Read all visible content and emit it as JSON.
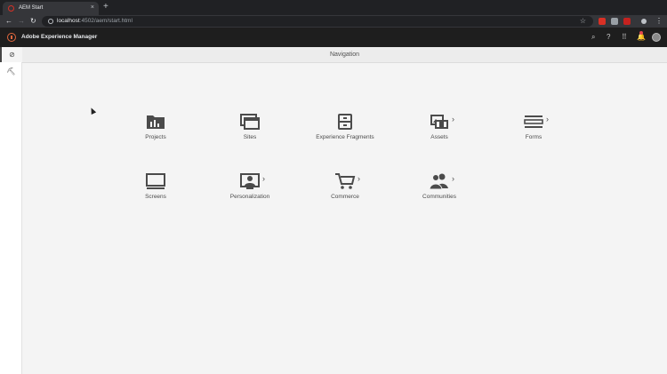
{
  "browser": {
    "tab_title": "AEM Start",
    "tab_close": "×",
    "new_tab": "+",
    "url_host": "localhost",
    "url_rest": ":4502/aem/start.html",
    "star": "☆"
  },
  "appbar": {
    "title": "Adobe Experience Manager",
    "brand_color": "#e3683e",
    "icons": [
      "search-icon",
      "help-icon",
      "apps-grid-icon",
      "notifications-icon",
      "user-avatar"
    ]
  },
  "rail": {
    "items": [
      {
        "icon": "compass-icon",
        "glyph": "⊘"
      },
      {
        "icon": "tools-icon",
        "glyph": "⛏"
      }
    ]
  },
  "page": {
    "title": "Navigation"
  },
  "tiles": [
    {
      "label": "Projects",
      "icon": "projects-icon",
      "has_chevron": false
    },
    {
      "label": "Sites",
      "icon": "sites-icon",
      "has_chevron": false
    },
    {
      "label": "Experience Fragments",
      "icon": "experience-fragments-icon",
      "has_chevron": false
    },
    {
      "label": "Assets",
      "icon": "assets-icon",
      "has_chevron": true
    },
    {
      "label": "Forms",
      "icon": "forms-icon",
      "has_chevron": true
    },
    {
      "label": "Screens",
      "icon": "screens-icon",
      "has_chevron": false
    },
    {
      "label": "Personalization",
      "icon": "personalization-icon",
      "has_chevron": true
    },
    {
      "label": "Commerce",
      "icon": "commerce-icon",
      "has_chevron": true
    },
    {
      "label": "Communities",
      "icon": "communities-icon",
      "has_chevron": true
    }
  ],
  "chevron_glyph": "›"
}
